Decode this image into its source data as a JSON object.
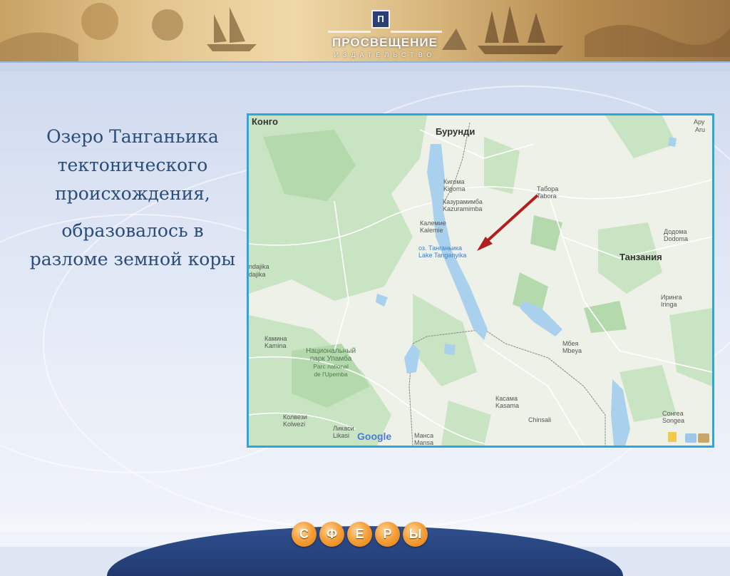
{
  "publisher": {
    "logo_glyph": "П",
    "name": "ПРОСВЕЩЕНИЕ",
    "subtitle": "ИЗДАТЕЛЬСТВО"
  },
  "slide_text": {
    "line1": "Озеро Танганьика тектонического происхождения,",
    "line2": "образовалось в разломе земной коры"
  },
  "map": {
    "attribution": "Google",
    "labels": {
      "congo": "Конго",
      "burundi": "Бурунди",
      "kigoma_ru": "Кигома",
      "kigoma_en": "Kigoma",
      "kazuramimba_ru": "Казурамимба",
      "kazuramimba_en": "Kazuramimba",
      "kalemie_ru": "Калемие",
      "kalemie_en": "Kalemie",
      "lake_ru": "оз. Танганьика",
      "lake_en": "Lake Tanganyika",
      "tabora_ru": "Табора",
      "tabora_en": "Tabora",
      "dodoma_ru": "Додома",
      "dodoma_en": "Dodoma",
      "tanzania": "Танзания",
      "iringa_ru": "Иринга",
      "iringa_en": "Iringa",
      "mbeya_ru": "Мбея",
      "mbeya_en": "Mbeya",
      "kamina_ru": "Камина",
      "kamina_en": "Kamina",
      "park_ru_1": "Национальный",
      "park_ru_2": "парк Упамба",
      "park_fr_1": "Parc national",
      "park_fr_2": "de l'Upemba",
      "kolwezi_ru": "Колвези",
      "kolwezi_en": "Kolwezi",
      "likasi_ru": "Ликаси",
      "likasi_en": "Likasi",
      "mansa_ru": "Манса",
      "mansa_en": "Mansa",
      "kasama_ru": "Касама",
      "kasama_en": "Kasama",
      "chinsali": "Chinsali",
      "songea_ru": "Сонгеа",
      "songea_en": "Songea",
      "arusha_ru": "Ару",
      "arusha_en": "Aru",
      "kabinda_part": "ndajika",
      "kabinda_part2": "dajika"
    },
    "colors": {
      "land": "#eef1e7",
      "forest": "#c9e4c2",
      "forest_dark": "#b4d9ad",
      "water": "#a9d1ee",
      "road": "#ffffff",
      "border": "#8a8a8a",
      "arrow": "#b21e1e"
    }
  },
  "footer": {
    "letters": [
      "С",
      "Ф",
      "Е",
      "Р",
      "Ы"
    ]
  }
}
